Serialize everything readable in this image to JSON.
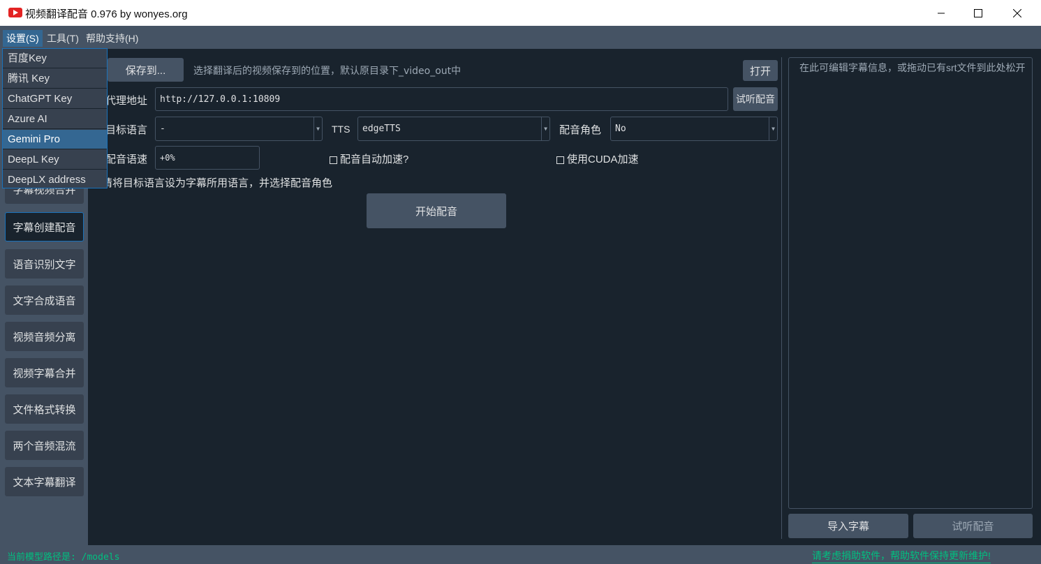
{
  "window": {
    "title": "视频翻译配音 0.976 by wonyes.org",
    "controls": {
      "minimize": "—",
      "maximize": "☐",
      "close": "✕"
    }
  },
  "menubar": {
    "items": [
      "设置(S)",
      "工具(T)",
      "帮助支持(H)"
    ]
  },
  "dropdown": {
    "items": [
      "百度Key",
      "腾讯 Key",
      "ChatGPT Key",
      "Azure AI",
      "Gemini Pro",
      "DeepL Key",
      "DeepLX address"
    ],
    "active_index": 4
  },
  "sidebar": {
    "items": [
      "字幕视频合并",
      "字幕创建配音",
      "语音识别文字",
      "文字合成语音",
      "视频音频分离",
      "视频字幕合并",
      "文件格式转换",
      "两个音频混流",
      "文本字幕翻译"
    ],
    "active_index": 1
  },
  "main": {
    "save_button": "保存到...",
    "save_hint": "选择翻译后的视频保存到的位置，默认原目录下_video_out中",
    "open_button": "打开",
    "proxy_label": "代理地址",
    "proxy_value": "http://127.0.0.1:10809",
    "listen_button": "试听配音",
    "target_lang_label": "目标语言",
    "target_lang_value": "-",
    "tts_label": "TTS",
    "tts_value": "edgeTTS",
    "voice_role_label": "配音角色",
    "voice_role_value": "No",
    "speed_label": "配音语速",
    "speed_value": "+0%",
    "auto_speed_label": "配音自动加速?",
    "cuda_label": "使用CUDA加速",
    "hint_text": "请将目标语言设为字幕所用语言，并选择配音角色",
    "start_button": "开始配音"
  },
  "right_panel": {
    "placeholder": "在此可编辑字幕信息，或拖动已有srt文件到此处松开",
    "import_button": "导入字幕",
    "listen_button": "试听配音"
  },
  "statusbar": {
    "left_text": "当前模型路径是: /models",
    "right_text": "请考虑捐助软件，帮助软件保持更新维护!"
  },
  "colors": {
    "background": "#19232d",
    "panel": "#455364",
    "accent": "#346792",
    "status_text": "#00c080"
  }
}
